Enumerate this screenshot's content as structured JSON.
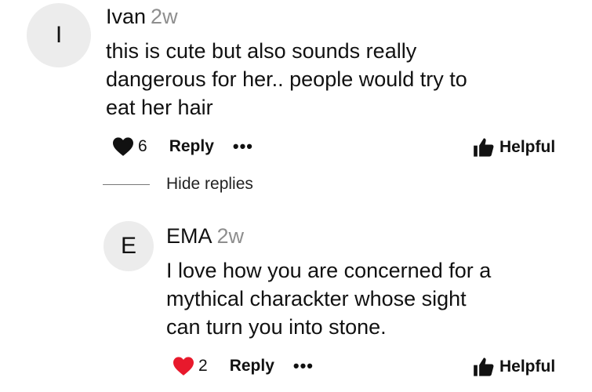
{
  "comment": {
    "avatar_letter": "I",
    "author": "Ivan",
    "age": "2w",
    "text_lines": [
      "this is cute but also sounds really",
      "dangerous for her.. people would try to",
      "eat her hair"
    ],
    "likes": "6",
    "liked": false,
    "reply_label": "Reply",
    "more_label": "•••",
    "helpful_label": "Helpful"
  },
  "thread": {
    "hide_replies_label": "Hide replies"
  },
  "reply": {
    "avatar_letter": "E",
    "author": "EMA",
    "age": "2w",
    "text_lines": [
      "I love how you are concerned for a",
      "mythical charackter whose sight",
      "can turn you into stone."
    ],
    "likes": "2",
    "liked": true,
    "reply_label": "Reply",
    "more_label": "•••",
    "helpful_label": "Helpful"
  },
  "colors": {
    "liked_heart": "#e8192c",
    "heart": "#111111",
    "muted": "#8e8e8e"
  }
}
